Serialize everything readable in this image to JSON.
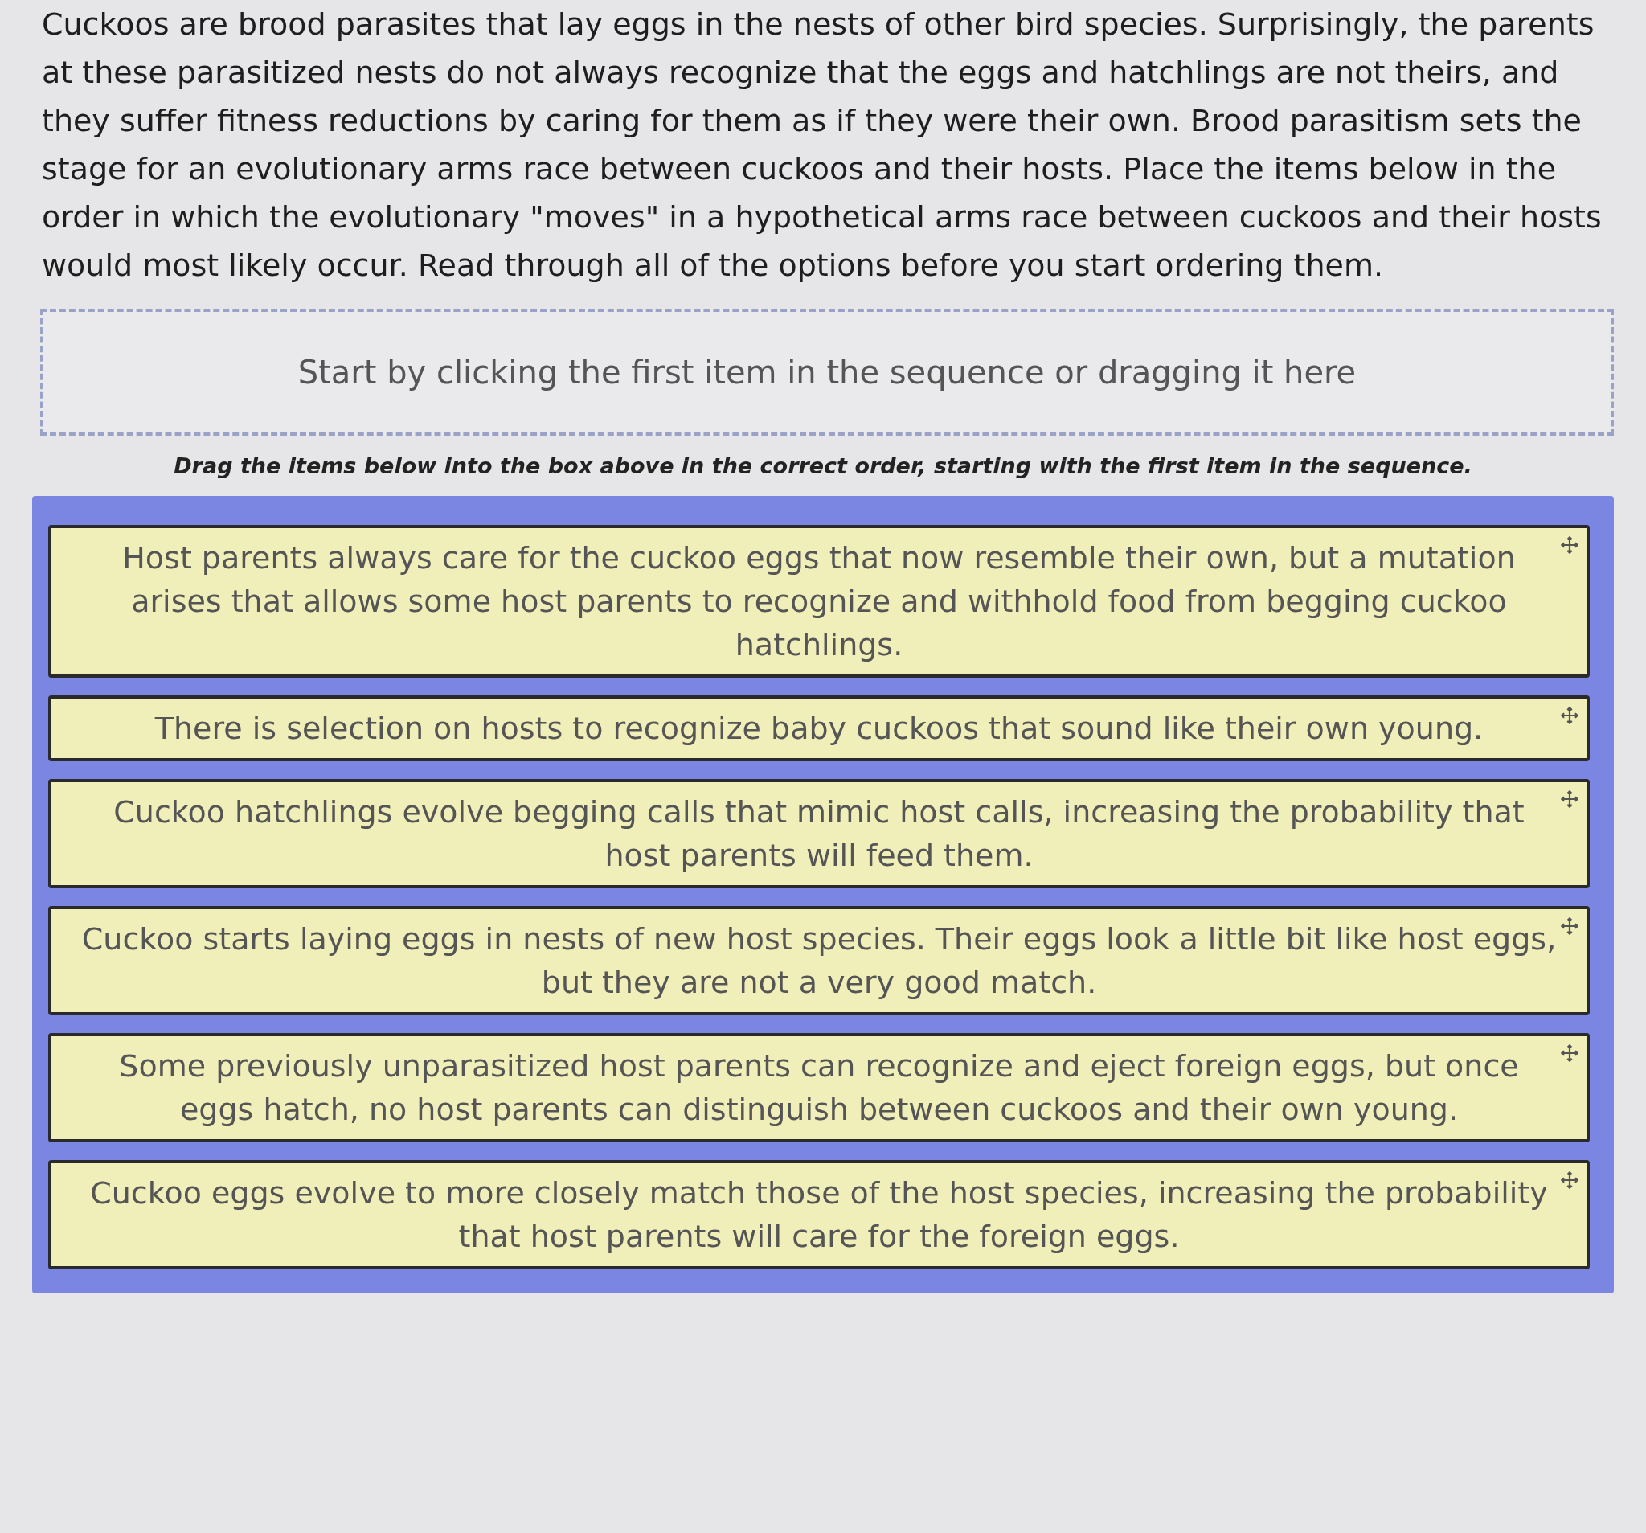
{
  "question": "Cuckoos are brood parasites that lay eggs in the nests of other bird species. Surprisingly, the parents at these parasitized nests do not always recognize that the eggs and hatchlings are not theirs, and they suffer fitness reductions by caring for them as if they were their own. Brood parasitism sets the stage for an evolutionary arms race between cuckoos and their hosts. Place the items below in the order in which the evolutionary \"moves\" in a hypothetical arms race between cuckoos and their hosts would most likely occur. Read through all of the options before you start ordering them.",
  "drop_zone": {
    "placeholder": "Start by clicking the first item in the sequence or dragging it here"
  },
  "instruction": "Drag the items below into the box above in the correct order, starting with the first item in the sequence.",
  "items": [
    {
      "text": "Host parents always care for the cuckoo eggs that now resemble their own, but a mutation arises that allows some host parents to recognize and withhold food from begging cuckoo hatchlings."
    },
    {
      "text": "There is selection on hosts to recognize baby cuckoos that sound like their own young."
    },
    {
      "text": "Cuckoo hatchlings evolve begging calls that mimic host calls, increasing the probability that host parents will feed them."
    },
    {
      "text": "Cuckoo starts laying eggs in nests of new host species. Their eggs look a little bit like host eggs, but they are not a very good match."
    },
    {
      "text": "Some previously unparasitized host parents can recognize and eject foreign eggs, but once eggs hatch, no host parents can distinguish between cuckoos and their own young."
    },
    {
      "text": "Cuckoo eggs evolve to more closely match those of the host species, increasing the probability that host parents will care for the foreign eggs."
    }
  ]
}
